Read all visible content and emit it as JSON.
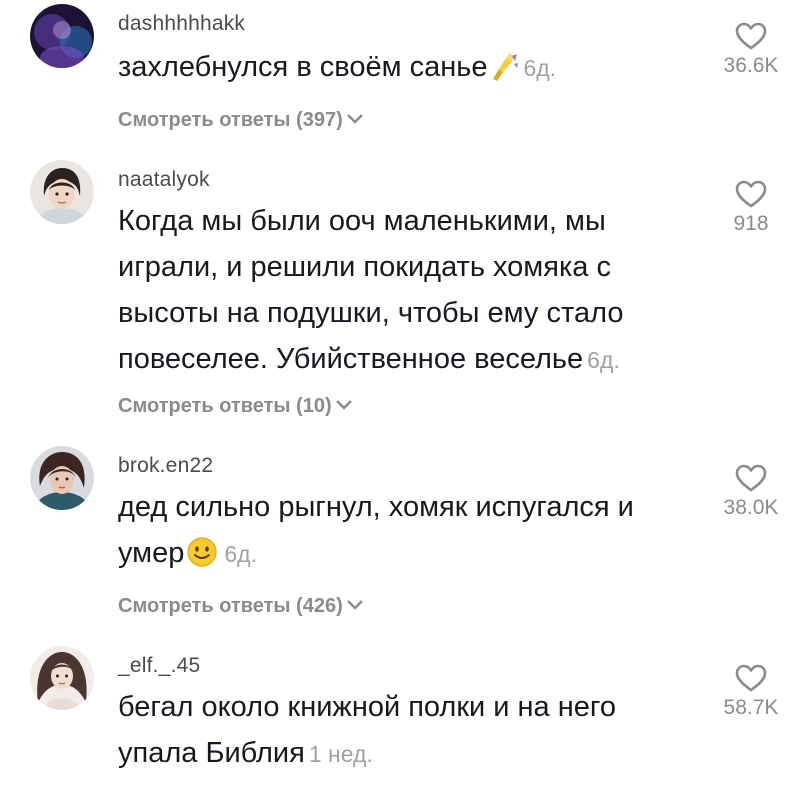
{
  "comments": [
    {
      "username": "dashhhhhakk",
      "text": "захлебнулся в своём санье",
      "time": "6д.",
      "likes": "36.6K",
      "replies": "Смотреть ответы (397)",
      "emoji": "nail-polish-icon"
    },
    {
      "username": "naatalyok",
      "text": "Когда мы были ооч маленькими, мы играли, и решили покидать хомяка с высоты на подушки, чтобы ему стало повеселее. Убийственное веселье",
      "time": "6д.",
      "likes": "918",
      "replies": "Смотреть ответы (10)"
    },
    {
      "username": "brok.en22",
      "text": "дед сильно рыгнул, хомяк испугался и умер",
      "time": "6д.",
      "likes": "38.0K",
      "replies": "Смотреть ответы (426)",
      "emoji": "smiling-face-icon"
    },
    {
      "username": "_elf._.45",
      "text": "бегал около книжной полки и на него упала Библия",
      "time": "1 нед.",
      "likes": "58.7K"
    }
  ],
  "colors": {
    "text": "#161823",
    "secondary": "#8a8b91",
    "username": "#4a4a52",
    "time": "#a0a1a7"
  }
}
